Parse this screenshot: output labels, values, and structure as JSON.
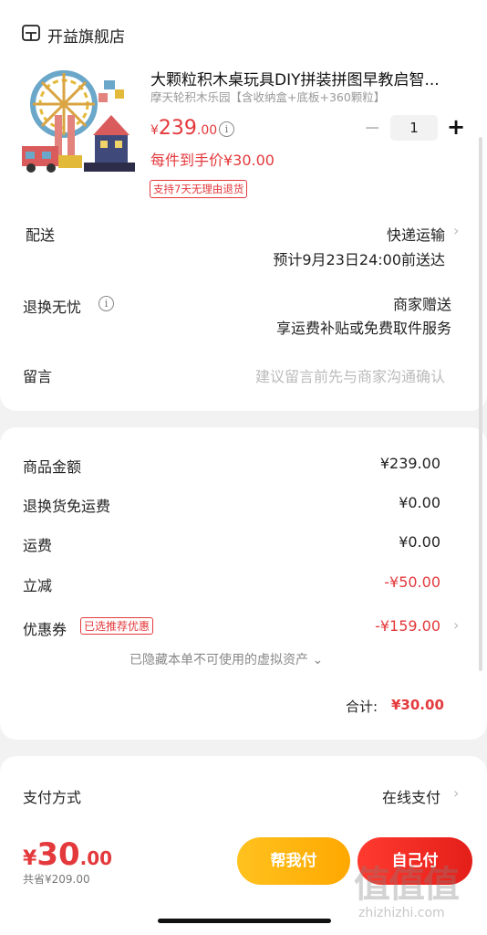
{
  "store": {
    "name": "开益旗舰店",
    "icon": "store-icon"
  },
  "product": {
    "title": "大颗粒积木桌玩具DIY拼装拼图早教启智...",
    "spec": "摩天轮积木乐园【含收纳盒+底板+360颗粒】",
    "price_currency": "¥",
    "price_int": "239",
    "price_dec": ".00",
    "quantity": "1",
    "minus": "−",
    "plus": "+",
    "per_price": "每件到手价¥30.00",
    "return_tag": "支持7天无理由退货"
  },
  "delivery": {
    "label": "配送",
    "method": "快递运输",
    "estimate": "预计9月23日24:00前送达"
  },
  "worry_free": {
    "label": "退换无忧",
    "value": "商家赠送",
    "desc": "享运费补贴或免费取件服务"
  },
  "message": {
    "label": "留言",
    "placeholder": "建议留言前先与商家沟通确认"
  },
  "summary": {
    "goods_label": "商品金额",
    "goods_value": "¥239.00",
    "return_label": "退换货免运费",
    "return_value": "¥0.00",
    "shipping_label": "运费",
    "shipping_value": "¥0.00",
    "discount_label": "立减",
    "discount_value": "-¥50.00",
    "coupon_label": "优惠券",
    "coupon_tag": "已选推荐优惠",
    "coupon_value": "-¥159.00",
    "hidden_note": "已隐藏本单不可使用的虚拟资产 ⌄",
    "total_label": "合计:",
    "total_value": "¥30.00"
  },
  "payment": {
    "label": "支付方式",
    "value": "在线支付"
  },
  "bottom": {
    "currency": "¥",
    "pay_int": "30",
    "pay_dec": ".00",
    "saved": "共省¥209.00",
    "help_pay": "帮我付",
    "self_pay": "自己付",
    "watermark": "值值值",
    "watermark_url": "zhizhizhi.com"
  },
  "colors": {
    "accent_red": "#e4393c",
    "help_yellow": "#ffb300",
    "pay_red": "#f0251d"
  },
  "info_icon": "ⓘ",
  "chevron": "›"
}
